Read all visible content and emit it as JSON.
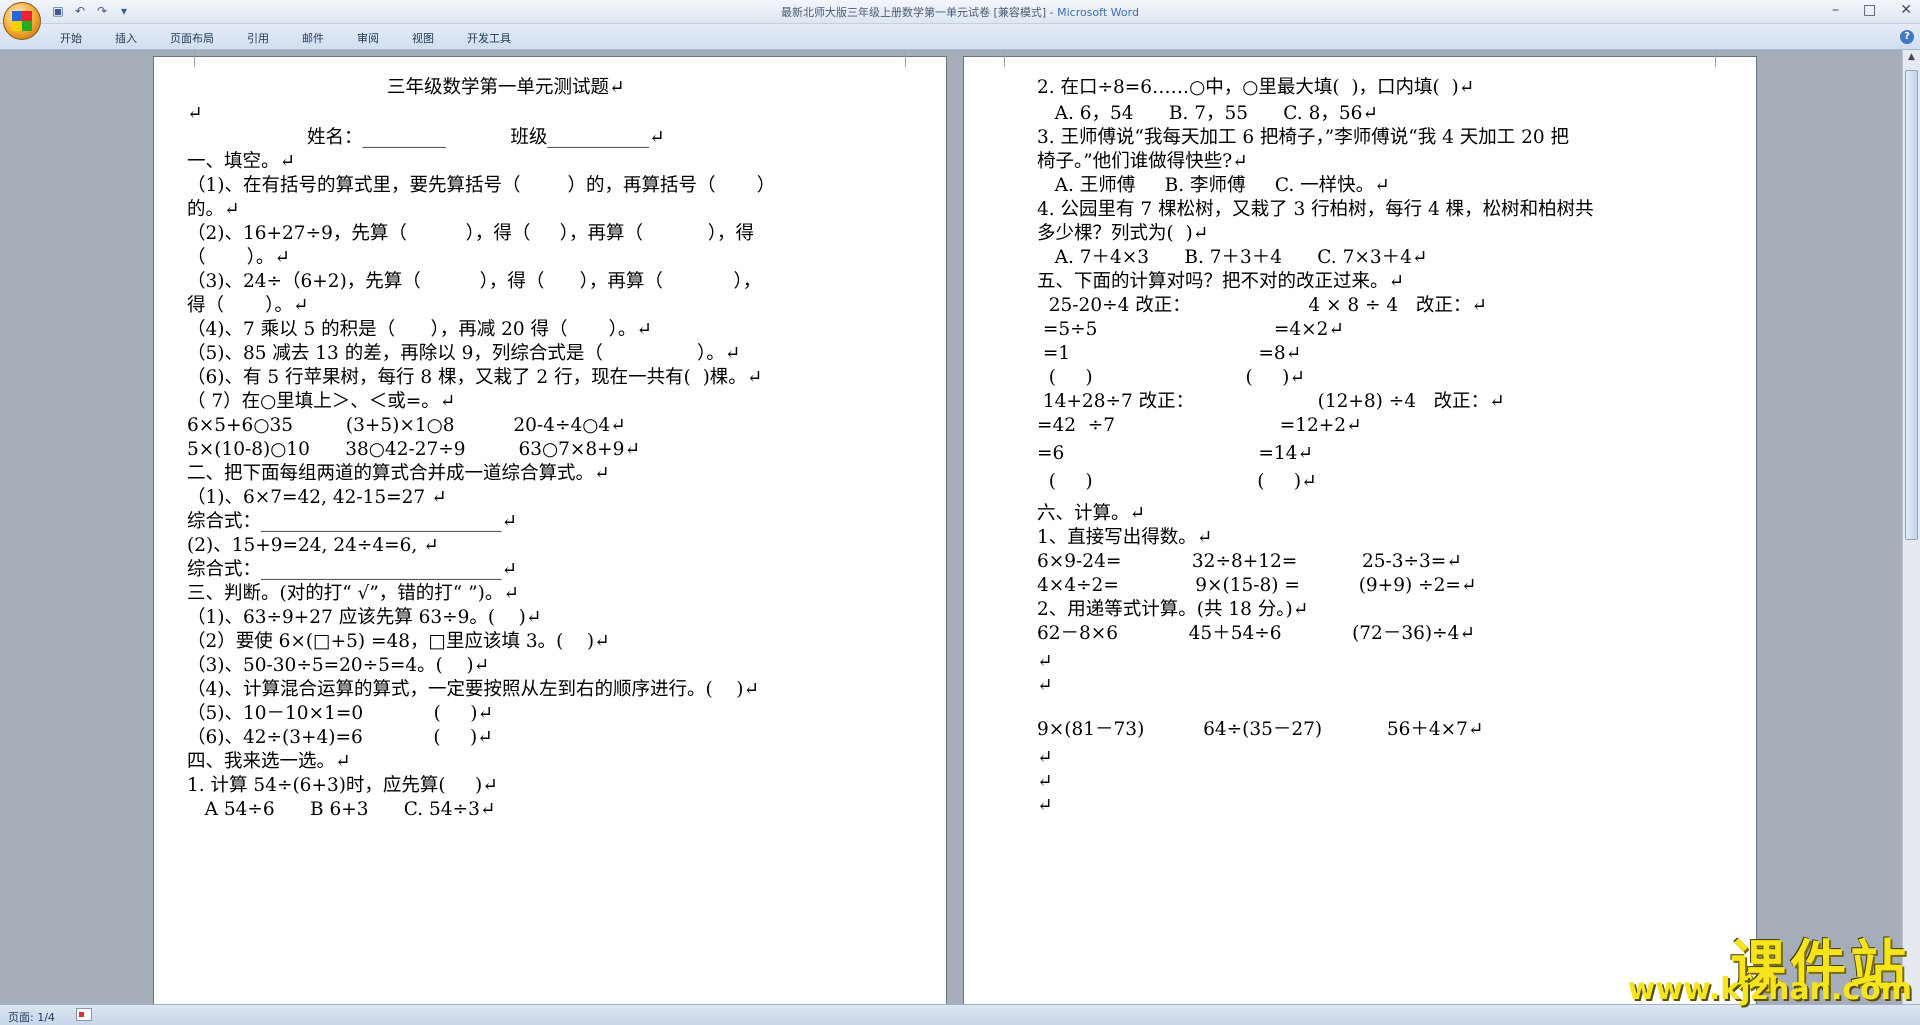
{
  "window": {
    "title": "最新北师大版三年级上册数学第一单元试卷 [兼容模式] - ",
    "app": "Microsoft Word"
  },
  "ribbon": {
    "tabs": [
      "开始",
      "插入",
      "页面布局",
      "引用",
      "邮件",
      "审阅",
      "视图",
      "开发工具"
    ]
  },
  "quick_access": [
    "save-icon",
    "undo-icon",
    "redo-icon",
    "customize-icon"
  ],
  "status": {
    "page": "页面: 1/4"
  },
  "watermark": {
    "title": "课件站",
    "url": "www.kjzhan.com"
  },
  "page_left": {
    "lines": [
      "三年级数学第一单元测试题↵",
      "↵",
      "姓名：_________           班级___________↵",
      "一、填空。↵",
      "（1)、在有括号的算式里，要先算括号（        ）的，再算括号（       ）",
      "的。↵",
      "（2)、16+27÷9，先算（          ），得（     ），再算（           ），得",
      "（       ）。↵",
      "（3)、24÷（6+2)，先算（          ），得（      ），再算（            ），",
      "得（       ）。↵",
      "（4)、7 乘以 5 的积是（      ），再减 20 得（       ）。↵",
      "（5)、85 减去 13 的差，再除以 9，列综合式是（                ）。↵",
      "（6)、有 5 行苹果树，每行 8 棵，又栽了 2 行，现在一共有(  )棵。↵",
      "（ 7）在○里填上＞、＜或=。↵",
      "6×5+6○35         (3+5)×1○8          20-4÷4○4↵",
      "5×(10-8)○10      38○42-27÷9         63○7×8+9↵",
      "二、把下面每组两道的算式合并成一道综合算式。↵",
      "（1)、6×7=42, 42-15=27 ↵",
      "综合式：__________________________↵",
      "(2)、15+9=24, 24÷4=6, ↵",
      "综合式：__________________________↵",
      "三、判断。(对的打“ √”，错的打“ ”)。↵",
      "（1)、63÷9+27 应该先算 63÷9。(    )↵",
      "（2）要使 6×(□+5) =48，□里应该填 3。(    )↵",
      "（3)、50-30÷5=20÷5=4。(    )↵",
      "（4)、计算混合运算的算式，一定要按照从左到右的顺序进行。(    )↵",
      "（5)、10－10×1=0            (     )↵",
      "（6)、42÷(3+4)=6            (     )↵",
      "四、我来选一选。↵",
      "1. 计算 54÷(6+3)时，应先算(     )↵",
      "   A 54÷6      B 6+3      C. 54÷3↵"
    ]
  },
  "page_right": {
    "lines": [
      "2. 在口÷8=6……○中，○里最大填(  )，口内填(  )↵",
      "   A. 6，54      B. 7，55      C. 8，56↵",
      "3. 王师傅说“我每天加工 6 把椅子，”李师傅说“我 4 天加工 20 把",
      "椅子。”他们谁做得快些?↵",
      "   A. 王师傅     B. 李师傅     C. 一样快。↵",
      "4. 公园里有 7 棵松树，又栽了 3 行柏树，每行 4 棵，松树和柏树共",
      "多少棵？列式为(  )↵",
      "   A. 7＋4×3      B. 7＋3＋4      C. 7×3＋4↵",
      "五、下面的计算对吗？把不对的改正过来。↵",
      "  25-20÷4 改正：                    4 × 8 ÷ 4   改正：↵",
      " =5÷5                              =4×2↵",
      " =1                                =8↵",
      "  (     )                          (     )↵",
      " 14+28÷7 改正：                     (12+8) ÷4   改正：↵",
      "=42  ÷7                            =12+2↵",
      "=6                                 =14↵",
      "  (     )                            (     )↵",
      "六、计算。↵",
      "1、直接写出得数。↵",
      "6×9-24=            32÷8+12=           25-3÷3=↵",
      "4×4÷2=             9×(15-8) =          (9+9) ÷2=↵",
      "2、用递等式计算。(共 18 分。)↵",
      "62－8×6            45＋54÷6            (72－36)÷4↵",
      "↵",
      "↵",
      "9×(81－73)          64÷(35－27)           56＋4×7↵",
      "↵",
      "↵",
      "↵"
    ]
  }
}
